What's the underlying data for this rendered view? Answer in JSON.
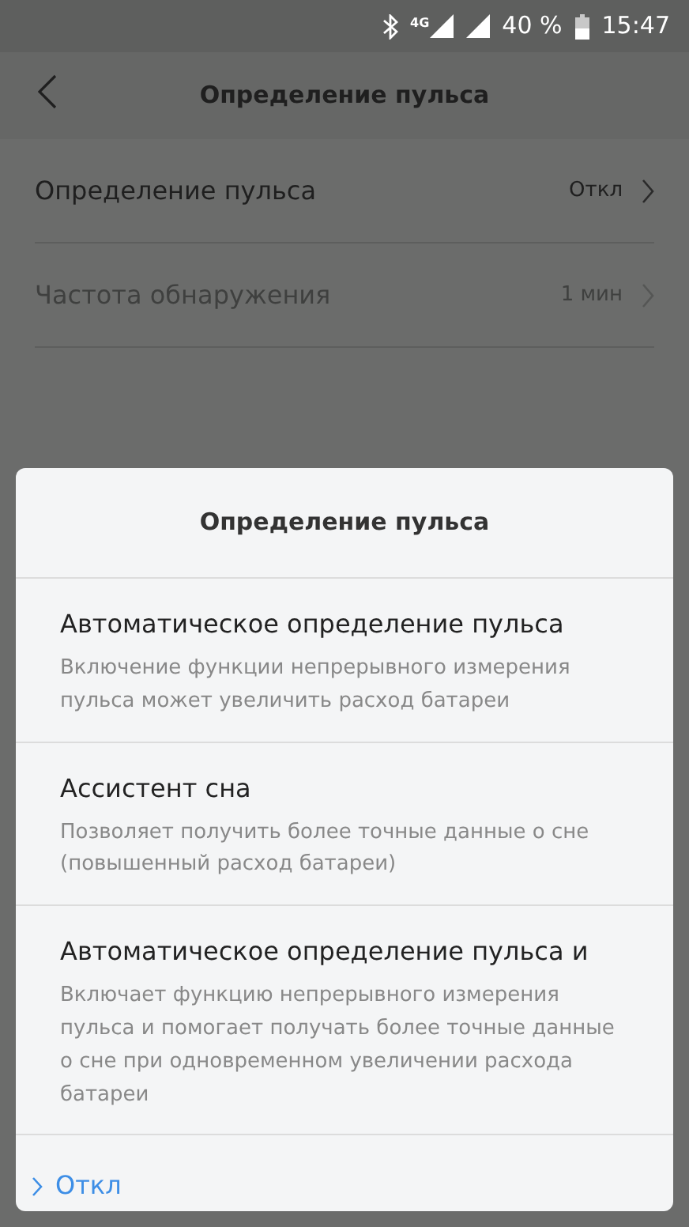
{
  "status_bar": {
    "network": "4G",
    "battery": "40 %",
    "time": "15:47"
  },
  "header": {
    "title": "Определение пульса"
  },
  "settings": [
    {
      "label": "Определение пульса",
      "value": "Откл",
      "disabled": false
    },
    {
      "label": "Частота обнаружения",
      "value": "1 мин",
      "disabled": true
    }
  ],
  "dialog": {
    "title": "Определение пульса",
    "options": [
      {
        "title": "Автоматическое определение пульса",
        "description": "Включение функции непрерывного измерения пульса может увеличить расход батареи",
        "selected": false
      },
      {
        "title": "Ассистент сна",
        "description": "Позволяет получить более точные данные о сне (повышенный расход батареи)",
        "selected": false
      },
      {
        "title": "Автоматическое определение пульса и",
        "description": "Включает функцию непрерывного измерения пульса и помогает получать более точные данные о сне при одновременном увеличении расхода батареи",
        "selected": false
      },
      {
        "title": "Откл",
        "selected": true
      }
    ]
  }
}
